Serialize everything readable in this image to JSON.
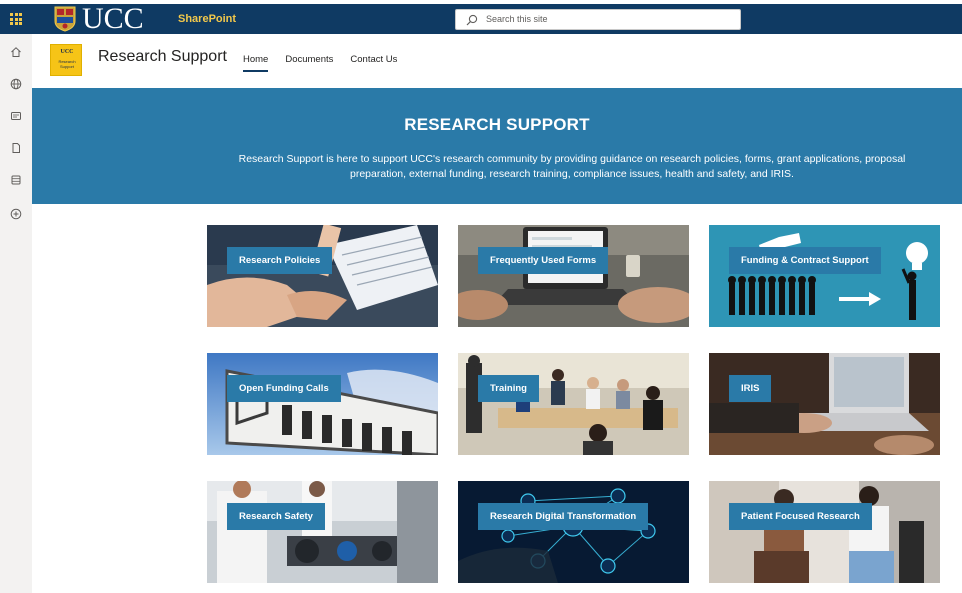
{
  "suite_bar": {
    "logo_text": "UCC",
    "app_name": "SharePoint",
    "search_placeholder": "Search this site"
  },
  "site": {
    "logo_line1": "UCC",
    "logo_line2": "Research",
    "logo_line3": "Support",
    "title": "Research Support",
    "nav": [
      {
        "label": "Home",
        "active": true
      },
      {
        "label": "Documents",
        "active": false
      },
      {
        "label": "Contact Us",
        "active": false
      }
    ]
  },
  "hero": {
    "title": "RESEARCH SUPPORT",
    "description": "Research Support is here to support UCC's research community by providing guidance on research policies, forms, grant applications, proposal preparation, external funding, research training, compliance issues, health and safety, and IRIS."
  },
  "tiles": [
    {
      "label": "Research Policies",
      "image": "documents-handshake-photo"
    },
    {
      "label": "Frequently Used Forms",
      "image": "laptop-typing-photo"
    },
    {
      "label": "Funding & Contract Support",
      "image": "silhouettes-lightbulb-graphic"
    },
    {
      "label": "Open Funding Calls",
      "image": "funding-sign-photo"
    },
    {
      "label": "Training",
      "image": "classroom-meeting-photo"
    },
    {
      "label": "IRIS",
      "image": "laptop-desk-photo"
    },
    {
      "label": "Research Safety",
      "image": "lab-equipment-photo"
    },
    {
      "label": "Research Digital Transformation",
      "image": "digital-network-graphic"
    },
    {
      "label": "Patient Focused Research",
      "image": "patient-nurse-photo"
    }
  ],
  "app_bar_icons": [
    "home-icon",
    "globe-icon",
    "news-icon",
    "files-icon",
    "lists-icon",
    "create-icon"
  ],
  "colors": {
    "suite_bar": "#0f3a63",
    "brand_yellow": "#f2c84b",
    "hero_blue": "#2a7aa8"
  }
}
